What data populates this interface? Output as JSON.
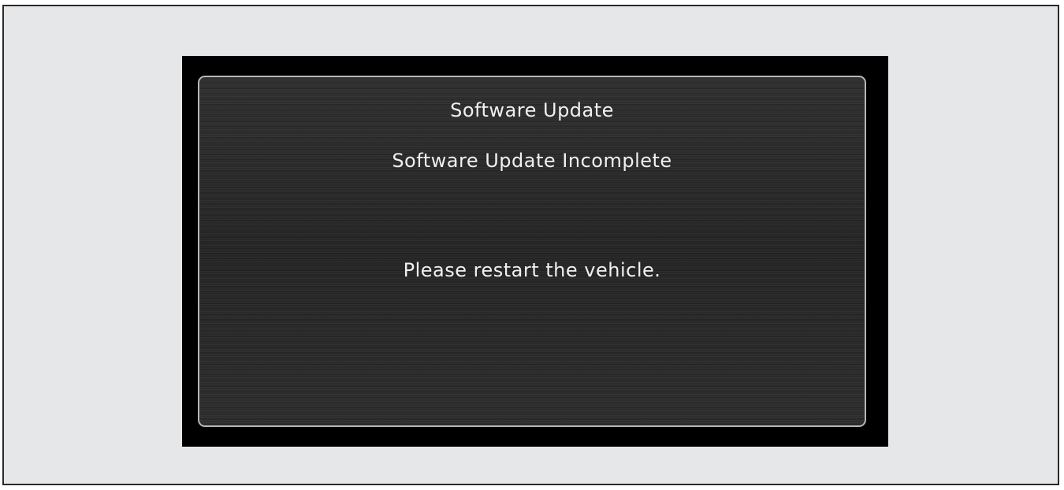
{
  "dialog": {
    "title": "Software Update",
    "status": "Software Update Incomplete",
    "message": "Please restart the vehicle."
  },
  "colors": {
    "page_background": "#e6e7e8",
    "screen_bezel": "#000000",
    "dialog_background": "#2b2b2b",
    "dialog_border": "#b7b7b7",
    "text": "#f0f0f0",
    "banner_text": "#d42a1c"
  }
}
